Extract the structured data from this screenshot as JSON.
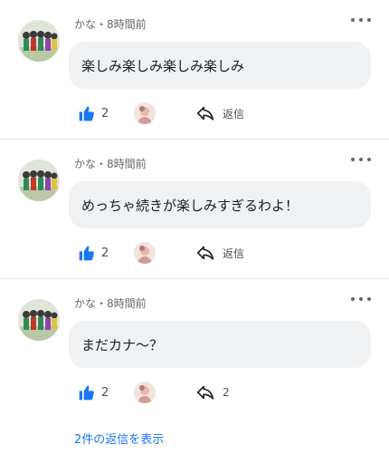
{
  "comments": [
    {
      "author": "かな",
      "separator": "・",
      "time": "8時間前",
      "text": "楽しみ楽しみ楽しみ楽しみ",
      "like_count": "2",
      "reply_label": "返信"
    },
    {
      "author": "かな",
      "separator": "・",
      "time": "8時間前",
      "text": "めっちゃ続きが楽しみすぎるわよ！",
      "like_count": "2",
      "reply_label": "返信"
    },
    {
      "author": "かな",
      "separator": "・",
      "time": "8時間前",
      "text": "まだカナ〜？",
      "like_count": "2",
      "reply_label": "2"
    }
  ],
  "view_replies_link": "2件の返信を表示",
  "colors": {
    "like_blue": "#1877f2",
    "link_blue": "#1877f2",
    "bubble_bg": "#eff1f3",
    "meta_gray": "#65676b"
  },
  "icons": [
    "more-options-icon",
    "thumbs-up-icon",
    "reply-arrow-icon"
  ]
}
